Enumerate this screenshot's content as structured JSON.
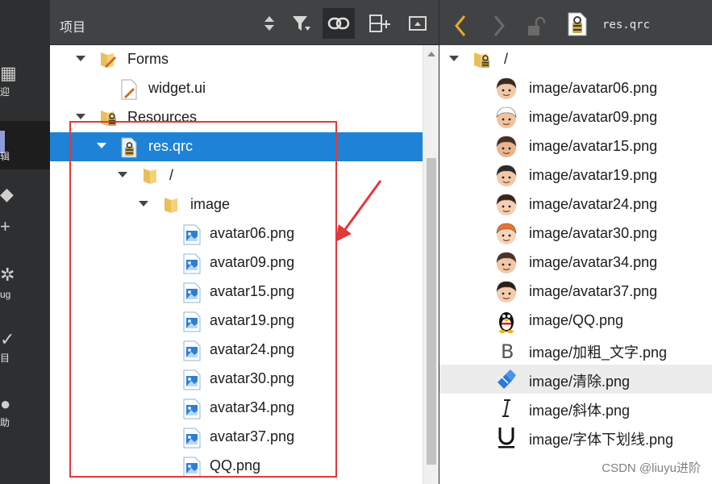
{
  "modebar": {
    "items": [
      {
        "label": "迎",
        "glyph": "▦",
        "active": false
      },
      {
        "label": "辑",
        "glyph": "",
        "active": true
      },
      {
        "label": "",
        "glyph": "◆",
        "active": false
      },
      {
        "label": "",
        "glyph": "+",
        "active": false
      },
      {
        "label": "ug",
        "glyph": "✲",
        "active": false
      },
      {
        "label": "目",
        "glyph": "✓",
        "active": false
      },
      {
        "label": "助",
        "glyph": "●",
        "active": false
      }
    ]
  },
  "left_pane": {
    "title": "项目",
    "toolbar_icons": [
      "sort-arrows-icon",
      "filter-icon",
      "link-icon",
      "split-add-icon",
      "minimize-icon"
    ],
    "tree": [
      {
        "label": "Forms",
        "icon": "folder-pen-icon",
        "depth": 0,
        "expanded": true
      },
      {
        "label": "widget.ui",
        "icon": "ui-file-icon",
        "depth": 1,
        "leaf": true
      },
      {
        "label": "Resources",
        "icon": "folder-lock-icon",
        "depth": 0,
        "expanded": true
      },
      {
        "label": "res.qrc",
        "icon": "qrc-file-icon",
        "depth": 1,
        "expanded": true,
        "selected": true
      },
      {
        "label": "/",
        "icon": "folder-icon",
        "depth": 2,
        "expanded": true
      },
      {
        "label": "image",
        "icon": "folder-icon",
        "depth": 3,
        "expanded": true
      },
      {
        "label": "avatar06.png",
        "icon": "image-file-icon",
        "depth": 4,
        "leaf": true
      },
      {
        "label": "avatar09.png",
        "icon": "image-file-icon",
        "depth": 4,
        "leaf": true
      },
      {
        "label": "avatar15.png",
        "icon": "image-file-icon",
        "depth": 4,
        "leaf": true
      },
      {
        "label": "avatar19.png",
        "icon": "image-file-icon",
        "depth": 4,
        "leaf": true
      },
      {
        "label": "avatar24.png",
        "icon": "image-file-icon",
        "depth": 4,
        "leaf": true
      },
      {
        "label": "avatar30.png",
        "icon": "image-file-icon",
        "depth": 4,
        "leaf": true
      },
      {
        "label": "avatar34.png",
        "icon": "image-file-icon",
        "depth": 4,
        "leaf": true
      },
      {
        "label": "avatar37.png",
        "icon": "image-file-icon",
        "depth": 4,
        "leaf": true
      },
      {
        "label": "QQ.png",
        "icon": "image-file-icon",
        "depth": 4,
        "leaf": true
      }
    ]
  },
  "right_pane": {
    "path": "res.qrc",
    "root": "/",
    "items": [
      {
        "label": "image/avatar06.png",
        "icon": "avatar-icon",
        "hair": "#3b2a1e",
        "skin": "#f2c9a8"
      },
      {
        "label": "image/avatar09.png",
        "icon": "avatar-icon",
        "hair": "#ffffff",
        "skin": "#f0c3a0"
      },
      {
        "label": "image/avatar15.png",
        "icon": "avatar-icon",
        "hair": "#4a2f1f",
        "skin": "#e9b48e"
      },
      {
        "label": "image/avatar19.png",
        "icon": "avatar-icon",
        "hair": "#2b2b2b",
        "skin": "#f2c9a8"
      },
      {
        "label": "image/avatar24.png",
        "icon": "avatar-icon",
        "hair": "#3a2519",
        "skin": "#f4cfb2"
      },
      {
        "label": "image/avatar30.png",
        "icon": "avatar-icon",
        "hair": "#e8762e",
        "skin": "#f6d4ba"
      },
      {
        "label": "image/avatar34.png",
        "icon": "avatar-icon",
        "hair": "#4d3324",
        "skin": "#f2c9a8"
      },
      {
        "label": "image/avatar37.png",
        "icon": "avatar-icon",
        "hair": "#2d1e16",
        "skin": "#f3cdb0"
      },
      {
        "label": "image/QQ.png",
        "icon": "qq-penguin-icon"
      },
      {
        "label": "image/加粗_文字.png",
        "icon": "bold-b-icon"
      },
      {
        "label": "image/清除.png",
        "icon": "eraser-icon",
        "hover": true
      },
      {
        "label": "image/斜体.png",
        "icon": "italic-i-icon"
      },
      {
        "label": "image/字体下划线.png",
        "icon": "underline-u-icon"
      }
    ]
  },
  "watermark": "CSDN @liuyu进阶",
  "colors": {
    "selection": "#1e83d6",
    "highlight_box": "#e0393a",
    "toolbar_bg": "#404244",
    "back_arrow": "#e8a92a"
  }
}
